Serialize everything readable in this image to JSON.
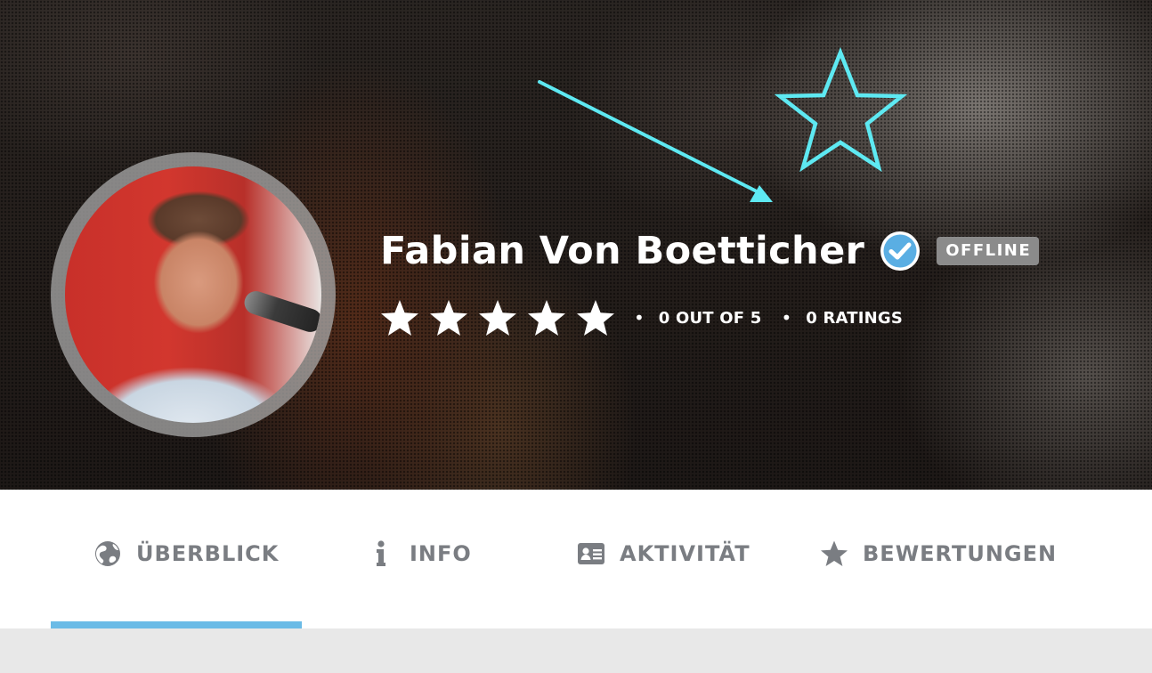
{
  "profile": {
    "name": "Fabian Von Boetticher",
    "status": "OFFLINE",
    "rating_text": "0 OUT OF 5",
    "ratings_count_text": "0 RATINGS",
    "rating_value": 0,
    "rating_max": 5,
    "verified": true
  },
  "tabs": [
    {
      "label": "ÜBERBLICK",
      "icon": "globe-icon",
      "active": true
    },
    {
      "label": "INFO",
      "icon": "info-icon",
      "active": false
    },
    {
      "label": "AKTIVITÄT",
      "icon": "id-card-icon",
      "active": false
    },
    {
      "label": "BEWERTUNGEN",
      "icon": "star-icon",
      "active": false
    }
  ],
  "colors": {
    "accent": "#6bbbe6",
    "annotation": "#5ee9f2",
    "verified": "#5aaee3",
    "badge": "#8b8b8b",
    "tab_text": "#7a7d82"
  }
}
